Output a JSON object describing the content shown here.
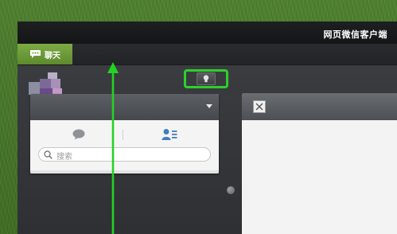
{
  "window": {
    "title": "网页微信客户端"
  },
  "nav": {
    "chat_tab_label": "聊天",
    "chat_tab_icon": "speech-bubble-icon"
  },
  "sidebar": {
    "tabs": [
      {
        "name": "chat",
        "icon": "chat-bubble-icon"
      },
      {
        "name": "contacts",
        "icon": "contacts-list-icon"
      }
    ],
    "search": {
      "placeholder": "搜索"
    }
  },
  "toolbar": {
    "bulb_icon": "lightbulb-icon"
  },
  "chat_window": {
    "close_icon": "close-icon"
  },
  "colors": {
    "accent_green": "#6c9a38",
    "highlight_green": "#2bd12b",
    "title_bar": "#1b1c1e",
    "panel_bg": "#f4f4f4"
  }
}
